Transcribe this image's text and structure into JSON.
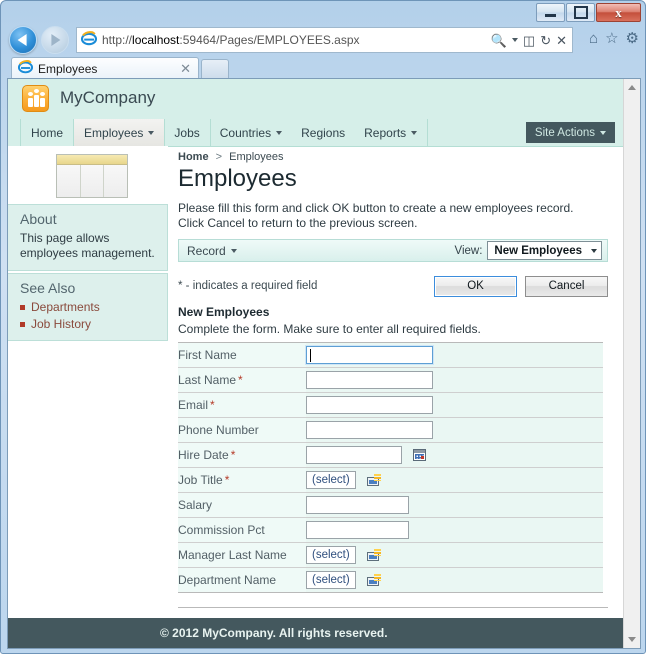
{
  "window": {
    "minimize_label": "Minimize",
    "maximize_label": "Maximize",
    "close_label": "x"
  },
  "browser": {
    "back_label": "Back",
    "forward_label": "Forward",
    "url_scheme": "http://",
    "url_host": "localhost",
    "url_path": ":59464/Pages/EMPLOYEES.aspx",
    "address_icons": [
      "search-icon",
      "caret-down-icon",
      "compatibility-view-icon",
      "refresh-icon",
      "stop-icon"
    ],
    "chrome_icons": [
      "home-icon",
      "favorites-icon",
      "tools-icon"
    ],
    "tab": {
      "title": "Employees",
      "close_label": "✕"
    }
  },
  "site": {
    "title": "MyCompany",
    "logo_icon": "people-icon",
    "nav": [
      {
        "label": "Home",
        "has_caret": false,
        "active": false
      },
      {
        "label": "Employees",
        "has_caret": true,
        "active": true
      },
      {
        "label": "Jobs",
        "has_caret": false,
        "active": false
      },
      {
        "label": "Countries",
        "has_caret": true,
        "active": false
      },
      {
        "label": "Regions",
        "has_caret": false,
        "active": false
      },
      {
        "label": "Reports",
        "has_caret": true,
        "active": false
      }
    ],
    "site_actions_label": "Site Actions"
  },
  "sidebar": {
    "about_title": "About",
    "about_text": "This page allows employees management.",
    "see_also_title": "See Also",
    "links": [
      {
        "label": "Departments"
      },
      {
        "label": "Job History"
      }
    ]
  },
  "main": {
    "breadcrumb_home": "Home",
    "breadcrumb_sep": ">",
    "breadcrumb_current": "Employees",
    "page_title": "Employees",
    "intro_line1": "Please fill this form and click OK button to create a new employees record.",
    "intro_line2": "Click Cancel to return to the previous screen.",
    "toolbar": {
      "record_label": "Record",
      "view_label": "View:",
      "view_selected": "New Employees"
    },
    "required_note": "* - indicates a required field",
    "ok_label": "OK",
    "cancel_label": "Cancel",
    "form_heading": "New Employees",
    "form_sub": "Complete the form. Make sure to enter all required fields.",
    "fields": [
      {
        "label": "First Name",
        "required": false,
        "control": "text",
        "value": "",
        "width": "focused"
      },
      {
        "label": "Last Name",
        "required": true,
        "control": "text",
        "value": "",
        "width": "w-lg"
      },
      {
        "label": "Email",
        "required": true,
        "control": "text",
        "value": "",
        "width": "w-lg"
      },
      {
        "label": "Phone Number",
        "required": false,
        "control": "text",
        "value": "",
        "width": "w-lg"
      },
      {
        "label": "Hire Date",
        "required": true,
        "control": "date",
        "value": "",
        "width": "w-sm"
      },
      {
        "label": "Job Title",
        "required": true,
        "control": "lookup",
        "value": "(select)"
      },
      {
        "label": "Salary",
        "required": false,
        "control": "text",
        "value": "",
        "width": "w-md"
      },
      {
        "label": "Commission Pct",
        "required": false,
        "control": "text",
        "value": "",
        "width": "w-md"
      },
      {
        "label": "Manager Last Name",
        "required": false,
        "control": "lookup",
        "value": "(select)"
      },
      {
        "label": "Department Name",
        "required": false,
        "control": "lookup",
        "value": "(select)"
      }
    ]
  },
  "footer": {
    "copyright": "© 2012 MyCompany. All rights reserved."
  },
  "colors": {
    "header_mint": "#d6efe9",
    "panel_mint": "#ddf0ec",
    "footer_dark": "#44585e",
    "accent_orange": "#fcb13c",
    "required_red": "#b53a28",
    "link_brown": "#8a4a3c"
  }
}
